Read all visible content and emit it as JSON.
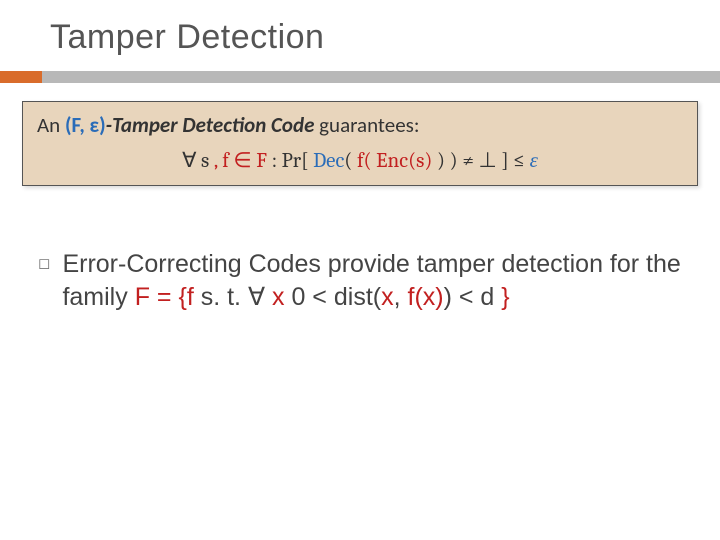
{
  "title": "Tamper Detection",
  "definition": {
    "prefix": "An ",
    "f_eps": "(F, ε)",
    "tdc_label": "-Tamper Detection Code ",
    "guarantees": " guarantees:",
    "formula_forall": "∀ s ",
    "formula_f_in_F": ", f ∈ F",
    "formula_pr_open": "  :  Pr[  ",
    "formula_dec": "Dec",
    "formula_open2": "( ",
    "formula_fenc": "f( Enc(s)",
    "formula_close2": " ) )  ≠ ⊥ ]  ≤  ",
    "formula_eps": "ε"
  },
  "bullet": {
    "text_part1": "Error-Correcting Codes provide tamper detection for the family ",
    "f_equals": "F = ",
    "brace_open": " {",
    "f_var": "f",
    "st": "   s. t.   ",
    "forall": "∀",
    "space": " ",
    "x": "x",
    "cond_open": "  0 < dist(",
    "x2": "x",
    "comma": ", ",
    "fx": "f(x)",
    "cond_close": ") < d ",
    "brace_close": "}"
  }
}
